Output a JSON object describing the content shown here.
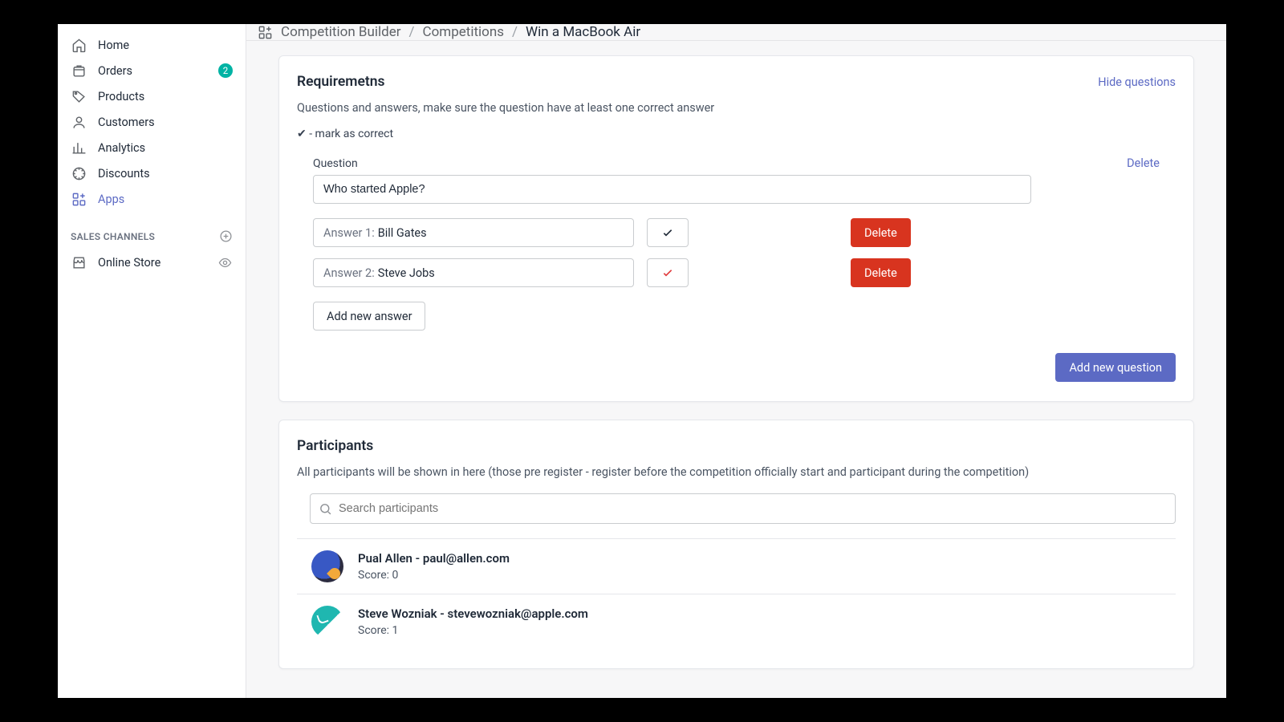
{
  "sidebar": {
    "items": [
      {
        "label": "Home"
      },
      {
        "label": "Orders",
        "badge": "2"
      },
      {
        "label": "Products"
      },
      {
        "label": "Customers"
      },
      {
        "label": "Analytics"
      },
      {
        "label": "Discounts"
      },
      {
        "label": "Apps"
      }
    ],
    "sales_channels_heading": "SALES CHANNELS",
    "channels": [
      {
        "label": "Online Store"
      }
    ]
  },
  "breadcrumb": {
    "a": "Competition Builder",
    "b": "Competitions",
    "c": "Win a MacBook Air"
  },
  "requirements": {
    "title": "Requiremetns",
    "hide_link": "Hide questions",
    "subtitle": "Questions and answers, make sure the question have at least one correct answer",
    "hint": "✔ - mark as correct",
    "question_label": "Question",
    "delete_q": "Delete",
    "question_value": "Who started Apple?",
    "answers": [
      {
        "prefix": "Answer 1:",
        "value": "Bill Gates",
        "correct": false,
        "delete": "Delete"
      },
      {
        "prefix": "Answer 2:",
        "value": "Steve Jobs",
        "correct": true,
        "delete": "Delete"
      }
    ],
    "add_answer": "Add new answer",
    "add_question": "Add new question"
  },
  "participants": {
    "title": "Participants",
    "subtitle": "All participants will be shown in here (those pre register - register before the competition officially start and participant during the competition)",
    "search_placeholder": "Search participants",
    "list": [
      {
        "name": "Pual Allen - paul@allen.com",
        "score": "Score: 0"
      },
      {
        "name": "Steve Wozniak - stevewozniak@apple.com",
        "score": "Score: 1"
      }
    ]
  }
}
